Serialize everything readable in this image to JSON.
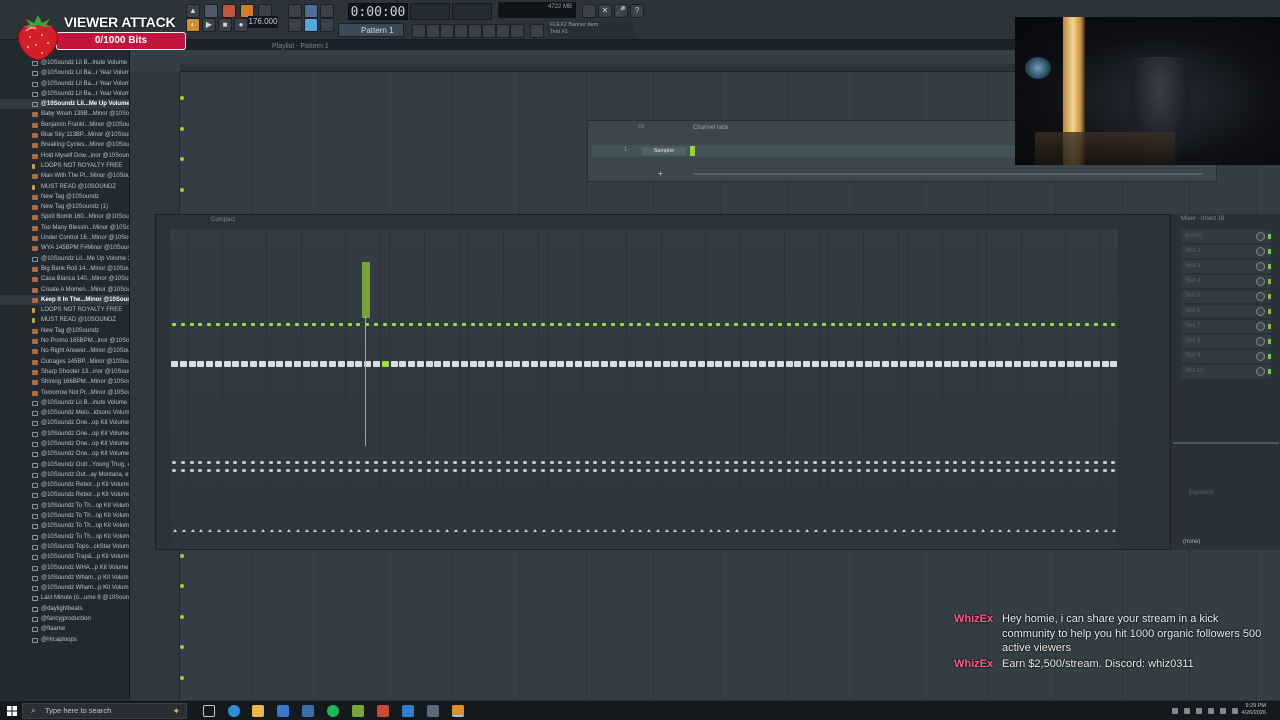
{
  "app": {
    "time_display": "0:00:00",
    "tempo": "176.000",
    "pattern": "Pattern 1",
    "memory": "4722 MB",
    "news_line1": "FLEX2 Banner Item",
    "news_line2": "Test #1",
    "playlist_title": "Playlist - Pattern 1"
  },
  "overlay": {
    "title": "VIEWER ATTACK",
    "bits": "0/1000 Bits"
  },
  "browser": {
    "items": [
      {
        "label": "@10Soundz Lil B...inute Volume 4",
        "kind": "folder"
      },
      {
        "label": "@10Soundz Lil Ba...r Year Volume 2",
        "kind": "folder"
      },
      {
        "label": "@10Soundz Lil Ba...r Year Volume 3",
        "kind": "folder"
      },
      {
        "label": "@10Soundz Lil Ba...r Year Volume 4",
        "kind": "folder"
      },
      {
        "label": "@10Soundz Lil...Me Up Volume 1",
        "kind": "folder",
        "hl": true
      },
      {
        "label": "Baby Woah 138B...Minor @10Soundz",
        "kind": "audio"
      },
      {
        "label": "Benjamin Frankl...Minor @10Soundz",
        "kind": "audio"
      },
      {
        "label": "Blue Sky 113BP...Minor @10Soundz",
        "kind": "audio"
      },
      {
        "label": "Breaking Cycles...Minor @10Soundz",
        "kind": "audio"
      },
      {
        "label": "Hold Myself Dow...inor @10Soundz",
        "kind": "audio"
      },
      {
        "label": "LOOPS NOT ROYALTY FREE",
        "kind": "text"
      },
      {
        "label": "Man With The Pl...Minor @10Soundz",
        "kind": "audio"
      },
      {
        "label": "MUST READ @10SOUNDZ",
        "kind": "text"
      },
      {
        "label": "New Tag @10Soundz",
        "kind": "audio"
      },
      {
        "label": "New Tag @10Soundz (1)",
        "kind": "audio"
      },
      {
        "label": "Spirit Bomb 160...Minor @10Soundz",
        "kind": "audio"
      },
      {
        "label": "Too Many Blessin...Minor @10Soundz",
        "kind": "audio"
      },
      {
        "label": "Under Control 16...Minor @10Soundz",
        "kind": "audio"
      },
      {
        "label": "WYA 145BPM F#Minor @10Soundz",
        "kind": "audio"
      },
      {
        "label": "@10Soundz Lil...Me Up Volume 2",
        "kind": "folder"
      },
      {
        "label": "Big Bank Roll 14...Minor @10Soundz",
        "kind": "audio"
      },
      {
        "label": "Casa Blanca 140...Minor @10Soundz",
        "kind": "audio"
      },
      {
        "label": "Create A Momen...Minor @10Soundz",
        "kind": "audio"
      },
      {
        "label": "Keep It In The...Minor @10Soundz",
        "kind": "audio",
        "hl": true
      },
      {
        "label": "LOOPS NOT ROYALTY FREE",
        "kind": "text"
      },
      {
        "label": "MUST READ @10SOUNDZ",
        "kind": "text"
      },
      {
        "label": "New Tag @10Soundz",
        "kind": "audio"
      },
      {
        "label": "No Promo 165BPM...inor @10Soundz",
        "kind": "audio"
      },
      {
        "label": "No Right Answer...Minor @10Soundz",
        "kind": "audio"
      },
      {
        "label": "Outrages 145BP...Minor @10Soundz",
        "kind": "audio"
      },
      {
        "label": "Sharp Shooter 13...inor @10Soundz",
        "kind": "audio"
      },
      {
        "label": "Shining 166BPM...Minor @10Soundz",
        "kind": "audio"
      },
      {
        "label": "Tomorrow Not Pr...Minor @10Soundz",
        "kind": "audio"
      },
      {
        "label": "@10Soundz Lil B...inute Volume 5",
        "kind": "folder"
      },
      {
        "label": "@10Soundz Melo...ldsons Volume 2",
        "kind": "folder"
      },
      {
        "label": "@10Soundz One...op Kit Volume 1",
        "kind": "folder"
      },
      {
        "label": "@10Soundz One...op Kit Volume 2",
        "kind": "folder"
      },
      {
        "label": "@10Soundz One...op Kit Volume 3",
        "kind": "folder"
      },
      {
        "label": "@10Soundz One...op Kit Volume 4",
        "kind": "folder"
      },
      {
        "label": "@10Soundz Outr...Young Thug, etc)",
        "kind": "folder"
      },
      {
        "label": "@10Soundz Out...ay Montana, etc)",
        "kind": "folder"
      },
      {
        "label": "@10Soundz Rebor...p Kit Volume 1",
        "kind": "folder"
      },
      {
        "label": "@10Soundz Rebor...p Kit Volume 2",
        "kind": "folder"
      },
      {
        "label": "@10Soundz To Th...op Kit Volume 1",
        "kind": "folder"
      },
      {
        "label": "@10Soundz To Th...op Kit Volume 2",
        "kind": "folder"
      },
      {
        "label": "@10Soundz To Th...op Kit Volume 3",
        "kind": "folder"
      },
      {
        "label": "@10Soundz To Th...op Kit Volume 4",
        "kind": "folder"
      },
      {
        "label": "@10Soundz Topo...ckStar Volume 3",
        "kind": "folder"
      },
      {
        "label": "@10Soundz Trap&...p Kit Volume 3",
        "kind": "folder"
      },
      {
        "label": "@10Soundz WHA...p Kit Volume 2",
        "kind": "folder"
      },
      {
        "label": "@10Soundz Wham...p Kit Volume 3",
        "kind": "folder"
      },
      {
        "label": "@10Soundz Wham...p Kit Volume 4",
        "kind": "folder"
      },
      {
        "label": "Last Minute (o...ume 8 @10Soundz",
        "kind": "folder"
      },
      {
        "label": "@daylightbeats",
        "kind": "folder"
      },
      {
        "label": "@fancyjproduction",
        "kind": "folder"
      },
      {
        "label": "@flaame",
        "kind": "folder"
      },
      {
        "label": "@Hicaploops",
        "kind": "folder"
      }
    ]
  },
  "channel_rack": {
    "title": "Channel rack",
    "filter": "All",
    "channel_name": "Sampler",
    "channel_number": "1"
  },
  "mixer": {
    "title": "Compact",
    "insert_title": "Mixer - Insert 16",
    "slots": [
      "(none)",
      "Slot 2",
      "Slot 3",
      "Slot 4",
      "Slot 5",
      "Slot 6",
      "Slot 7",
      "Slot 8",
      "Slot 9",
      "Slot 10"
    ],
    "equalizer": "Equalizer",
    "output": "(none)"
  },
  "chat": [
    {
      "user": "WhizEx",
      "text": "Hey homie, i can share your stream in a kick community to help you hit 1000 organic followers 500 active viewers"
    },
    {
      "user": "WhizEx",
      "text": "Earn $2,500/stream. Discord: whiz0311"
    }
  ],
  "taskbar": {
    "search_placeholder": "Type here to search",
    "time": "9:29 PM",
    "date": "4/26/2026"
  },
  "colors": {
    "accent_green": "#96d43a",
    "chat_user": "#ff5d8f",
    "overlay_red": "#c3143b"
  }
}
